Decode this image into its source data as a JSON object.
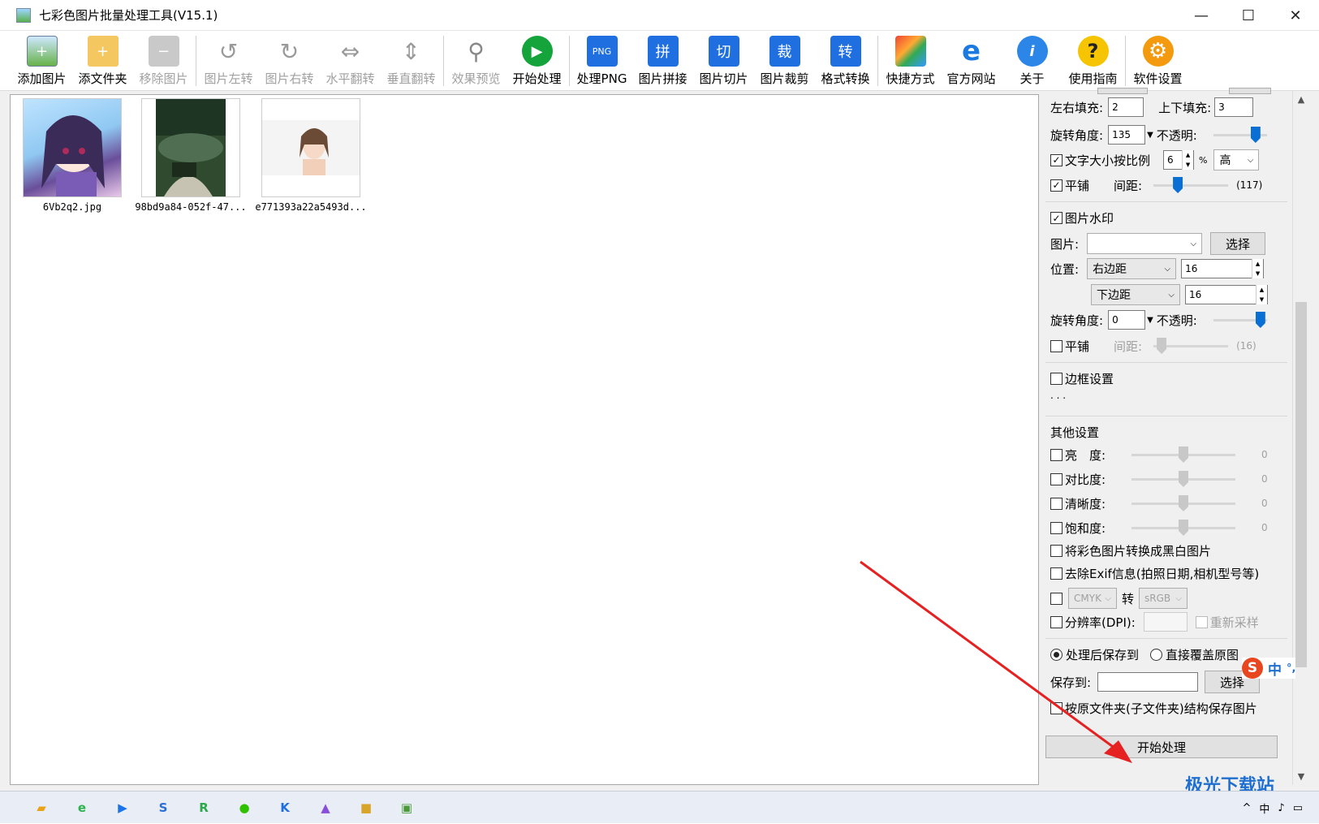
{
  "window": {
    "title": "七彩色图片批量处理工具(V15.1)",
    "minimize": "—",
    "maximize": "☐",
    "close": "✕"
  },
  "toolbar": [
    {
      "label": "添加图片",
      "icon": "add-image-icon",
      "glyph": "+",
      "enabled": true
    },
    {
      "label": "添文件夹",
      "icon": "add-folder-icon",
      "glyph": "+",
      "enabled": true
    },
    {
      "label": "移除图片",
      "icon": "remove-image-icon",
      "glyph": "−",
      "enabled": false
    },
    {
      "label": "图片左转",
      "icon": "rotate-left-icon",
      "glyph": "↺",
      "enabled": false
    },
    {
      "label": "图片右转",
      "icon": "rotate-right-icon",
      "glyph": "↻",
      "enabled": false
    },
    {
      "label": "水平翻转",
      "icon": "flip-horizontal-icon",
      "glyph": "⇔",
      "enabled": false
    },
    {
      "label": "垂直翻转",
      "icon": "flip-vertical-icon",
      "glyph": "⇕",
      "enabled": false
    },
    {
      "label": "效果预览",
      "icon": "preview-search-icon",
      "glyph": "⚲",
      "enabled": false
    },
    {
      "label": "开始处理",
      "icon": "play-icon",
      "glyph": "▶",
      "enabled": true
    },
    {
      "label": "处理PNG",
      "icon": "png-icon",
      "glyph": "PNG",
      "enabled": true
    },
    {
      "label": "图片拼接",
      "icon": "stitch-icon",
      "glyph": "拼",
      "enabled": true
    },
    {
      "label": "图片切片",
      "icon": "slice-icon",
      "glyph": "切",
      "enabled": true
    },
    {
      "label": "图片裁剪",
      "icon": "crop-icon",
      "glyph": "裁",
      "enabled": true
    },
    {
      "label": "格式转换",
      "icon": "convert-icon",
      "glyph": "转",
      "enabled": true
    },
    {
      "label": "快捷方式",
      "icon": "shortcut-cubes-icon",
      "glyph": "",
      "enabled": true
    },
    {
      "label": "官方网站",
      "icon": "ie-browser-icon",
      "glyph": "e",
      "enabled": true
    },
    {
      "label": "关于",
      "icon": "info-icon",
      "glyph": "i",
      "enabled": true
    },
    {
      "label": "使用指南",
      "icon": "help-icon",
      "glyph": "?",
      "enabled": true
    },
    {
      "label": "软件设置",
      "icon": "gear-icon",
      "glyph": "⚙",
      "enabled": true
    }
  ],
  "images": [
    {
      "name": "6Vb2q2.jpg"
    },
    {
      "name": "98bd9a84-052f-47..."
    },
    {
      "name": "e771393a22a5493d..."
    }
  ],
  "text_watermark": {
    "lr_pad_label": "左右填充:",
    "lr_pad": "2",
    "tb_pad_label": "上下填充:",
    "tb_pad": "3",
    "angle_label": "旋转角度:",
    "angle": "135",
    "opacity_label": "不透明:",
    "opacity": 0.85,
    "scale_label": "文字大小按比例",
    "scale": "6",
    "pct": "%",
    "quality": "高",
    "tile_label": "平铺",
    "spacing_label": "间距:",
    "spacing": "(117)",
    "spacing_level": 0.3
  },
  "image_watermark": {
    "title": "图片水印",
    "image_label": "图片:",
    "image_value": "",
    "choose": "选择",
    "pos_label": "位置:",
    "pos_x": "右边距",
    "pos_x_val": "16",
    "pos_y": "下边距",
    "pos_y_val": "16",
    "angle_label": "旋转角度:",
    "angle": "0",
    "opacity_label": "不透明:",
    "opacity": 0.97,
    "tile_label": "平铺",
    "spacing_label": "间距:",
    "spacing": "(16)",
    "spacing_level": 0.05
  },
  "border": {
    "title": "边框设置",
    "dots": ". . ."
  },
  "other": {
    "title": "其他设置",
    "sliders": [
      {
        "label": "亮　度:",
        "value": "0"
      },
      {
        "label": "对比度:",
        "value": "0"
      },
      {
        "label": "清晰度:",
        "value": "0"
      },
      {
        "label": "饱和度:",
        "value": "0"
      }
    ],
    "bw": "将彩色图片转换成黑白图片",
    "exif": "去除Exif信息(拍照日期,相机型号等)",
    "cmyk": "CMYK",
    "to": "转",
    "srgb": "sRGB",
    "dpi": "分辨率(DPI):",
    "resample": "重新采样"
  },
  "output": {
    "save_to_opt": "处理后保存到",
    "overwrite_opt": "直接覆盖原图",
    "save_label": "保存到:",
    "save_path": "",
    "choose": "选择",
    "keep_struct": "按原文件夹(子文件夹)结构保存图片",
    "start": "开始处理"
  },
  "ime": {
    "logo": "S",
    "mode": "中",
    "punct": "°,"
  },
  "watermark_text": "极光下载站",
  "taskbar": {
    "apps": [
      {
        "icon": "file-explorer-icon",
        "glyph": "▰",
        "color": "#e8a317"
      },
      {
        "icon": "ie-taskbar-icon",
        "glyph": "e",
        "color": "#2bb24c"
      },
      {
        "icon": "app-blue-icon",
        "glyph": "▶",
        "color": "#1a73e8"
      },
      {
        "icon": "browser-s-icon",
        "glyph": "S",
        "color": "#2b6fd6"
      },
      {
        "icon": "app-r-icon",
        "glyph": "R",
        "color": "#2aa84a"
      },
      {
        "icon": "wechat-icon",
        "glyph": "●",
        "color": "#2dc100"
      },
      {
        "icon": "app-k-icon",
        "glyph": "K",
        "color": "#1f6fe0"
      },
      {
        "icon": "mountain-app-icon",
        "glyph": "▲",
        "color": "#8a4fd8"
      },
      {
        "icon": "package-icon",
        "glyph": "■",
        "color": "#d8a52a"
      },
      {
        "icon": "image-tool-taskbar-icon",
        "glyph": "▣",
        "color": "#4b9a3a"
      }
    ],
    "tray_ime": "中"
  }
}
